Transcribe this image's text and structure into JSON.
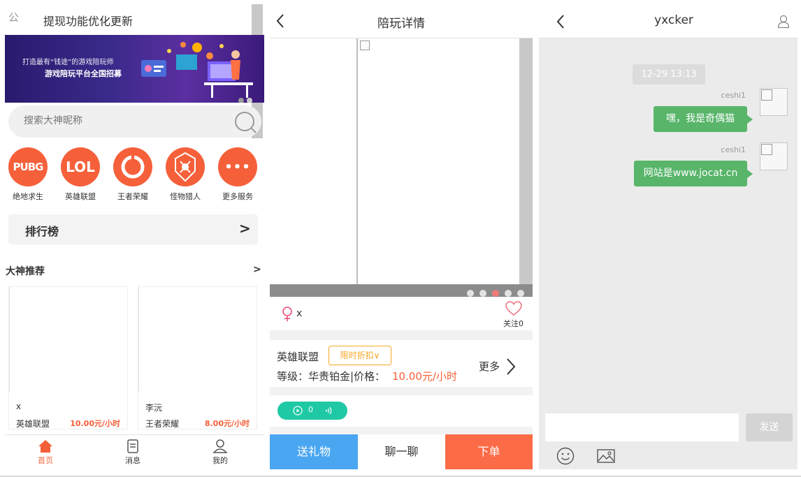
{
  "home": {
    "notice_tag": "公告",
    "notice_text": "提现功能优化更新",
    "banner": {
      "line1": "打造最有“钱途”的游戏陪玩师",
      "line2": "游戏陪玩平台全国招募"
    },
    "search_placeholder": "搜索大神昵称",
    "games": [
      {
        "label": "绝地求生",
        "badge": "PUBG"
      },
      {
        "label": "英雄联盟",
        "badge": "LOL"
      },
      {
        "label": "王者荣耀",
        "badge": ""
      },
      {
        "label": "怪物猎人",
        "badge": ""
      },
      {
        "label": "更多服务",
        "badge": "•••"
      }
    ],
    "rank_label": "排行榜",
    "rank_arrow": ">",
    "recommend_title": "大神推荐",
    "recommend_arrow": ">",
    "cards": [
      {
        "name": "x",
        "game": "英雄联盟",
        "price": "10.00元/小时"
      },
      {
        "name": "李沅",
        "game": "王者荣耀",
        "price": "8.00元/小时"
      }
    ],
    "tabs": [
      {
        "label": "首页",
        "icon": "home-icon"
      },
      {
        "label": "消息",
        "icon": "message-icon"
      },
      {
        "label": "我的",
        "icon": "user-icon"
      }
    ],
    "accent": "#f5603a"
  },
  "detail": {
    "title": "陪玩详情",
    "nickname": "x",
    "follow_label": "关注0",
    "game_name": "英雄联盟",
    "discount_label": "限时折扣∨",
    "level_label": "等级：华贵铂金|价格：",
    "price": "10.00元/小时",
    "more_label": "更多",
    "voice_count": "0",
    "actions": {
      "gift": "送礼物",
      "chat": "聊一聊",
      "order": "下单"
    },
    "colors": {
      "gift": "#4aa6f1",
      "order": "#fc6b47",
      "voice": "#20c9a6"
    }
  },
  "chat": {
    "title": "yxcker",
    "time": "12-29 13:13",
    "messages": [
      {
        "sender": "ceshi1",
        "text": "嘿，我是奇偶猫"
      },
      {
        "sender": "ceshi1",
        "text": "网站是www.jocat.cn"
      }
    ],
    "input_placeholder": "",
    "send_label": "发送",
    "bubble_color": "#58b56a"
  }
}
